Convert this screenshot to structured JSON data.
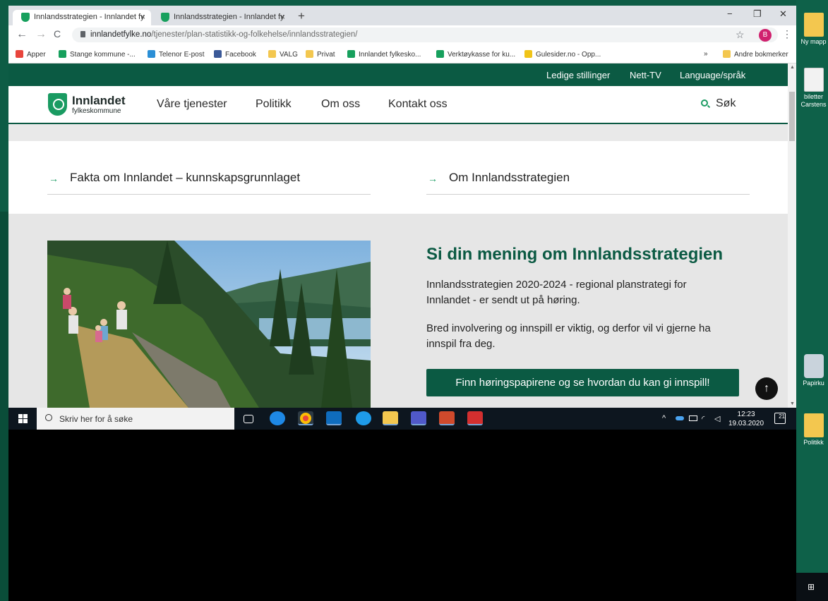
{
  "browser": {
    "tabs": [
      {
        "title": "Innlandsstrategien - Innlandet fy",
        "close": "×"
      },
      {
        "title": "Innlandsstrategien - Innlandet fy",
        "close": "×"
      }
    ],
    "new_tab": "+",
    "window_controls": {
      "minimize": "−",
      "restore": "❐",
      "close": "✕"
    },
    "nav": {
      "back": "←",
      "forward": "→",
      "reload": "C"
    },
    "url_host": "innlandetfylke.no",
    "url_path": "/tjenester/plan-statistikk-og-folkehelse/innlandsstrategien/",
    "star": "☆",
    "profile_initial": "B",
    "menu": "⋮",
    "bookmarks": [
      {
        "label": "Apper",
        "icon": "apps-icon",
        "color": "#e8453c"
      },
      {
        "label": "Stange kommune -...",
        "icon": "shield-icon",
        "color": "#17a05d"
      },
      {
        "label": "Telenor E-post",
        "icon": "telenor-icon",
        "color": "#2b8fd6"
      },
      {
        "label": "Facebook",
        "icon": "facebook-icon",
        "color": "#3b5998"
      },
      {
        "label": "VALG",
        "icon": "folder-icon",
        "color": "#f3c74f"
      },
      {
        "label": "Privat",
        "icon": "folder-icon",
        "color": "#f3c74f"
      },
      {
        "label": "Innlandet fylkesko...",
        "icon": "shield-icon",
        "color": "#17a05d"
      },
      {
        "label": "Verktøykasse for ku...",
        "icon": "shield-icon",
        "color": "#17a05d"
      },
      {
        "label": "Gulesider.no - Opp...",
        "icon": "gulesider-icon",
        "color": "#f0c419"
      }
    ],
    "bookmarks_more": "»",
    "other_bookmarks": "Andre bokmerker"
  },
  "site": {
    "top_links": [
      "Ledige stillinger",
      "Nett-TV",
      "Language/språk"
    ],
    "logo_name": "Innlandet",
    "logo_sub": "fylkeskommune",
    "nav": [
      "Våre tjenester",
      "Politikk",
      "Om oss",
      "Kontakt oss"
    ],
    "search_label": "Søk",
    "quick_links": [
      {
        "arrow": "→",
        "label": "Fakta om Innlandet – kunnskapsgrunnlaget"
      },
      {
        "arrow": "→",
        "label": "Om Innlandsstrategien"
      }
    ],
    "promo": {
      "title": "Si din mening om Innlandsstrategien",
      "paragraph1": "Innlandsstrategien 2020-2024 - regional planstrategi for Innlandet - er sendt ut på høring.",
      "paragraph2": "Bred involvering og innspill er viktig, og derfor vil vi gjerne ha innspil fra deg.",
      "cta": "Finn høringspapirene og se hvordan du kan gi innspill!"
    },
    "back_to_top": "↑"
  },
  "taskbar": {
    "search_placeholder": "Skriv her for å søke",
    "clock_time": "12:23",
    "clock_date": "19.03.2020",
    "notification_count": "21",
    "tray_caret": "^"
  },
  "desktop_icons": [
    {
      "label": "Ny mapp"
    },
    {
      "label": "biletter Carstens"
    },
    {
      "label": "Papirku"
    },
    {
      "label": "Politikk"
    }
  ]
}
